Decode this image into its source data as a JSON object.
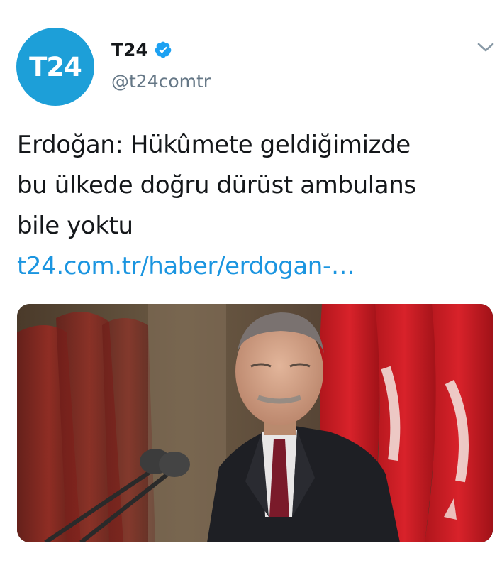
{
  "tweet": {
    "author": {
      "avatar_text": "T24",
      "display_name": "T24",
      "verified": true,
      "handle": "@t24comtr"
    },
    "text_lines": [
      "Erdoğan: Hükûmete geldiğimizde",
      "bu ülkede doğru dürüst ambulans",
      "bile yoktu"
    ],
    "link_text": "t24.com.tr/haber/erdogan-…",
    "media": {
      "description_icon": "photo",
      "kind": "image"
    }
  },
  "colors": {
    "brand": "#1d9fd8",
    "link": "#1b95e0",
    "verified": "#1da1f2",
    "handle": "#657786",
    "text": "#14171a"
  },
  "icons": {
    "verified": "verified-badge-icon",
    "caret": "chevron-down-icon"
  }
}
